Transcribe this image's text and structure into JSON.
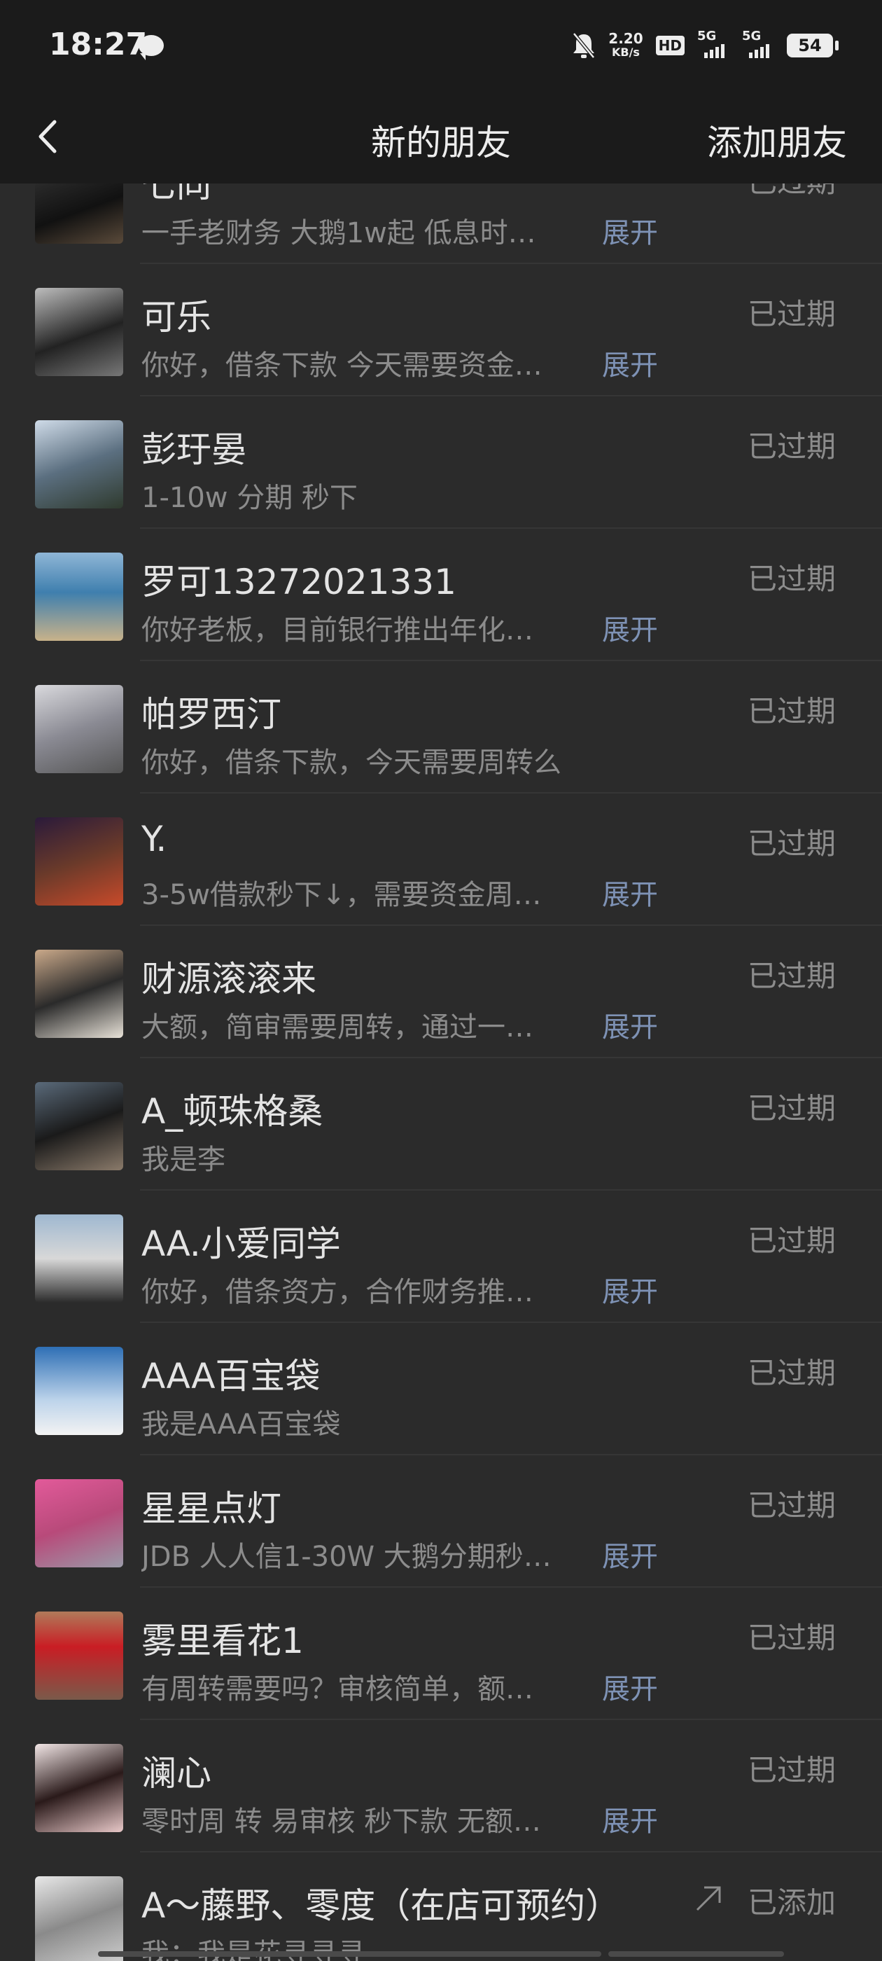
{
  "status_bar": {
    "time": "18:27",
    "net_speed_value": "2.20",
    "net_speed_unit": "KB/s",
    "hd_label": "HD",
    "signal1_label": "5G",
    "signal2_label": "5G",
    "battery": "54"
  },
  "nav": {
    "title": "新的朋友",
    "action": "添加朋友"
  },
  "colors": {
    "accent_link": "#7e92b5",
    "background": "#2b2b2b",
    "bar_background": "#1b1b1b"
  },
  "contacts": [
    {
      "name": "七同",
      "message": "一手老财务 大鹅1w起 低息时…",
      "expand": "展开",
      "status": "已过期"
    },
    {
      "name": "可乐",
      "message": "你好，借条下款 今天需要资金…",
      "expand": "展开",
      "status": "已过期"
    },
    {
      "name": "彭玗晏",
      "message": "1-10w 分期 秒下",
      "expand": "",
      "status": "已过期"
    },
    {
      "name": "罗可13272021331",
      "message": "你好老板，目前银行推出年化…",
      "expand": "展开",
      "status": "已过期"
    },
    {
      "name": "帕罗西汀",
      "message": "你好，借条下款，今天需要周转么",
      "expand": "",
      "status": "已过期"
    },
    {
      "name": "Y.",
      "message": "3-5w借款秒下↓，需要资金周…",
      "expand": "展开",
      "status": "已过期"
    },
    {
      "name": "财源滚滚来",
      "message": "大额，简审需要周转，通过一…",
      "expand": "展开",
      "status": "已过期"
    },
    {
      "name": "A_顿珠格桑",
      "message": "我是李",
      "expand": "",
      "status": "已过期"
    },
    {
      "name": "AA.小爱同学",
      "message": "你好，借条资方，合作财务推…",
      "expand": "展开",
      "status": "已过期"
    },
    {
      "name": "AAA百宝袋",
      "message": "我是AAA百宝袋",
      "expand": "",
      "status": "已过期"
    },
    {
      "name": "星星点灯",
      "message": "JDB 人人信1-30W 大鹅分期秒…",
      "expand": "展开",
      "status": "已过期"
    },
    {
      "name": "雾里看花1",
      "message": "有周转需要吗？审核简单，额…",
      "expand": "展开",
      "status": "已过期"
    },
    {
      "name": "澜心",
      "message": "零时周 转 易审核 秒下款 无额…",
      "expand": "展开",
      "status": "已过期"
    },
    {
      "name": "A～藤野、零度（在店可预约）",
      "message": "我：我是花寻寻寻",
      "expand": "",
      "status": "已添加"
    }
  ]
}
